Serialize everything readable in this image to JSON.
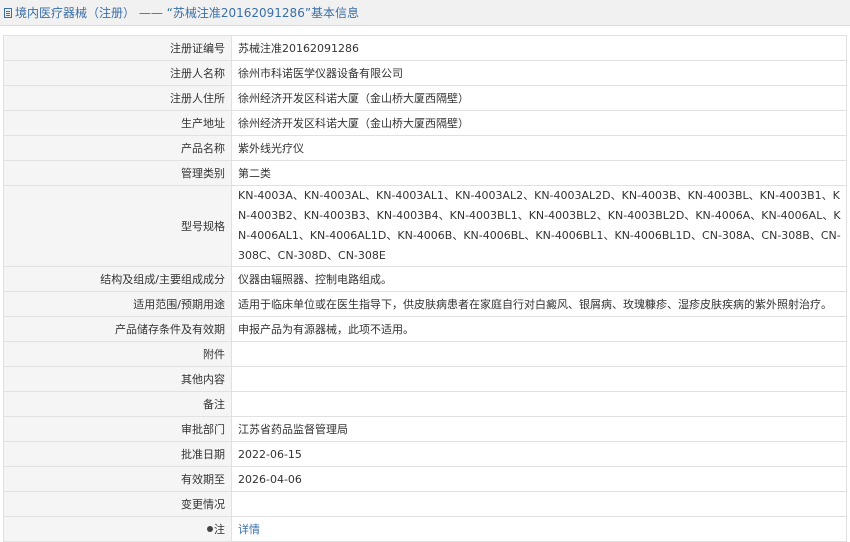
{
  "header": {
    "title": "境内医疗器械（注册） —— “苏械注准20162091286”基本信息"
  },
  "rows": [
    {
      "label": "注册证编号",
      "value": "苏械注准20162091286"
    },
    {
      "label": "注册人名称",
      "value": "徐州市科诺医学仪器设备有限公司"
    },
    {
      "label": "注册人住所",
      "value": "徐州经济开发区科诺大厦（金山桥大厦西隔壁）"
    },
    {
      "label": "生产地址",
      "value": "徐州经济开发区科诺大厦（金山桥大厦西隔壁）"
    },
    {
      "label": "产品名称",
      "value": "紫外线光疗仪"
    },
    {
      "label": "管理类别",
      "value": "第二类"
    },
    {
      "label": "型号规格",
      "value": "KN-4003A、KN-4003AL、KN-4003AL1、KN-4003AL2、KN-4003AL2D、KN-4003B、KN-4003BL、KN-4003B1、KN-4003B2、KN-4003B3、KN-4003B4、KN-4003BL1、KN-4003BL2、KN-4003BL2D、KN-4006A、KN-4006AL、KN-4006AL1、KN-4006AL1D、KN-4006B、KN-4006BL、KN-4006BL1、KN-4006BL1D、CN-308A、CN-308B、CN-308C、CN-308D、CN-308E"
    },
    {
      "label": "结构及组成/主要组成成分",
      "value": "仪器由辐照器、控制电路组成。"
    },
    {
      "label": "适用范围/预期用途",
      "value": "适用于临床单位或在医生指导下，供皮肤病患者在家庭自行对白癜风、银屑病、玫瑰糠疹、湿疹皮肤疾病的紫外照射治疗。"
    },
    {
      "label": "产品储存条件及有效期",
      "value": "申报产品为有源器械，此项不适用。"
    },
    {
      "label": "附件",
      "value": ""
    },
    {
      "label": "其他内容",
      "value": ""
    },
    {
      "label": "备注",
      "value": ""
    },
    {
      "label": "审批部门",
      "value": "江苏省药品监督管理局"
    },
    {
      "label": "批准日期",
      "value": "2022-06-15"
    },
    {
      "label": "有效期至",
      "value": "2026-04-06"
    },
    {
      "label": "变更情况",
      "value": ""
    }
  ],
  "note": {
    "label": "注",
    "link_text": "详情"
  }
}
